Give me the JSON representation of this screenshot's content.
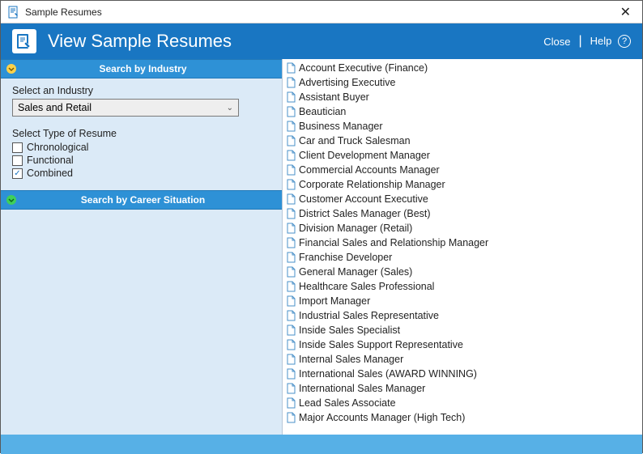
{
  "window": {
    "title": "Sample Resumes"
  },
  "header": {
    "title": "View Sample Resumes",
    "close_label": "Close",
    "help_label": "Help"
  },
  "sidebar": {
    "accordion1": {
      "label": "Search by Industry"
    },
    "industry": {
      "label": "Select an Industry",
      "selected": "Sales and Retail"
    },
    "resume_type": {
      "label": "Select Type of Resume",
      "options": [
        {
          "label": "Chronological",
          "checked": false
        },
        {
          "label": "Functional",
          "checked": false
        },
        {
          "label": "Combined",
          "checked": true
        }
      ]
    },
    "accordion2": {
      "label": "Search by Career Situation"
    }
  },
  "results": [
    "Account Executive (Finance)",
    "Advertising Executive",
    "Assistant Buyer",
    "Beautician",
    "Business Manager",
    "Car and Truck Salesman",
    "Client Development Manager",
    "Commercial Accounts Manager",
    "Corporate Relationship Manager",
    "Customer Account Executive",
    "District Sales Manager (Best)",
    "Division Manager (Retail)",
    "Financial Sales and Relationship Manager",
    "Franchise Developer",
    "General Manager (Sales)",
    "Healthcare Sales Professional",
    "Import Manager",
    "Industrial Sales Representative",
    "Inside Sales Specialist",
    "Inside Sales Support Representative",
    "Internal Sales Manager",
    "International Sales (AWARD WINNING)",
    "International Sales Manager",
    "Lead Sales Associate",
    "Major Accounts Manager (High Tech)"
  ],
  "colors": {
    "accent": "#1976c2",
    "accent_light": "#2e91d6",
    "panel_bg": "#dbeaf7"
  }
}
